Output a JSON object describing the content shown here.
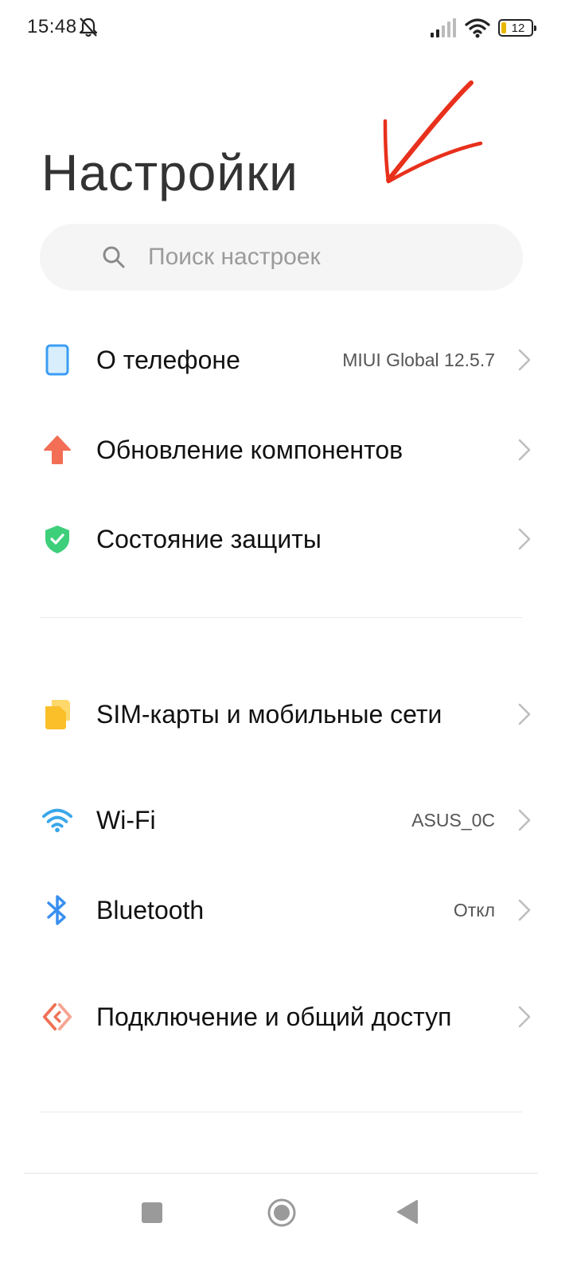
{
  "status_bar": {
    "time": "15:48",
    "battery": "12"
  },
  "title": "Настройки",
  "search": {
    "placeholder": "Поиск настроек"
  },
  "items": [
    {
      "label": "О телефоне",
      "value": "MIUI Global 12.5.7",
      "icon": "phone-icon",
      "color": "#3a9ef5"
    },
    {
      "label": "Обновление компонентов",
      "value": "",
      "icon": "update-arrow-icon",
      "color": "#f26e55"
    },
    {
      "label": "Состояние защиты",
      "value": "",
      "icon": "shield-check-icon",
      "color": "#3ecf7a"
    },
    {
      "label": "SIM-карты и мобильные сети",
      "value": "",
      "icon": "sim-card-icon",
      "color": "#fbbf2a"
    },
    {
      "label": "Wi-Fi",
      "value": "ASUS_0C",
      "icon": "wifi-icon",
      "color": "#3aa7ea"
    },
    {
      "label": "Bluetooth",
      "value": "Откл",
      "icon": "bluetooth-icon",
      "color": "#3a8ff0"
    },
    {
      "label": "Подключение и общий доступ",
      "value": "",
      "icon": "share-connection-icon",
      "color": "#ef7155"
    }
  ],
  "annotation": {
    "color": "#e8301c"
  }
}
